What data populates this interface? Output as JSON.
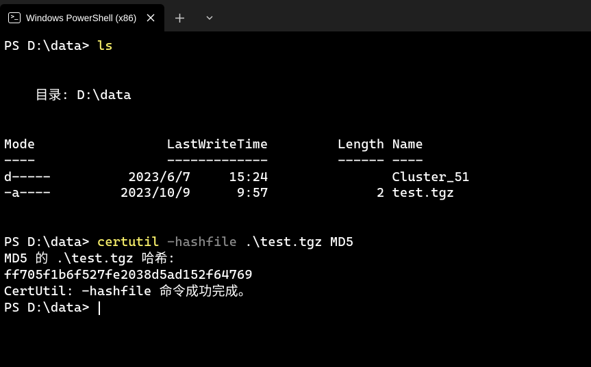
{
  "titlebar": {
    "tab_title": "Windows PowerShell (x86)"
  },
  "terminal": {
    "prompt": "PS D:\\data>",
    "cmd1": "ls",
    "dir_label": "    目录: D:\\data",
    "header_mode": "Mode",
    "header_lwt": "LastWriteTime",
    "header_length": "Length",
    "header_name": "Name",
    "sep_mode": "----",
    "sep_lwt": "-------------",
    "sep_length": "------",
    "sep_name": "----",
    "rows": [
      {
        "mode": "d-----",
        "date": "2023/6/7",
        "time": "15:24",
        "length": "",
        "name": "Cluster_51"
      },
      {
        "mode": "-a----",
        "date": "2023/10/9",
        "time": "9:57",
        "length": "2",
        "name": "test.tgz"
      }
    ],
    "cmd2_part1": "certutil",
    "cmd2_part2": "-hashfile",
    "cmd2_part3": " .\\test.tgz MD5",
    "out1": "MD5 的 .\\test.tgz 哈希:",
    "out2": "ff705f1b6f527fe2038d5ad152f64769",
    "out3": "CertUtil: -hashfile 命令成功完成。"
  }
}
